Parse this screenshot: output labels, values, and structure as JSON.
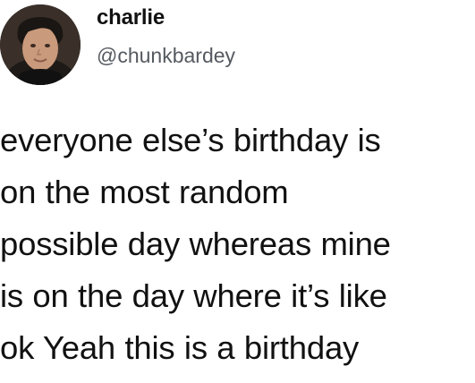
{
  "tweet": {
    "author": {
      "name": "charlie",
      "handle": "@chunkbardey"
    },
    "text_lines": [
      "everyone else’s birthday is",
      "on the most random",
      "possible day whereas mine",
      "is on the day where it’s like",
      "ok Yeah this is a birthday"
    ]
  },
  "colors": {
    "text": "#111111",
    "handle": "#555a60",
    "background": "#ffffff"
  }
}
